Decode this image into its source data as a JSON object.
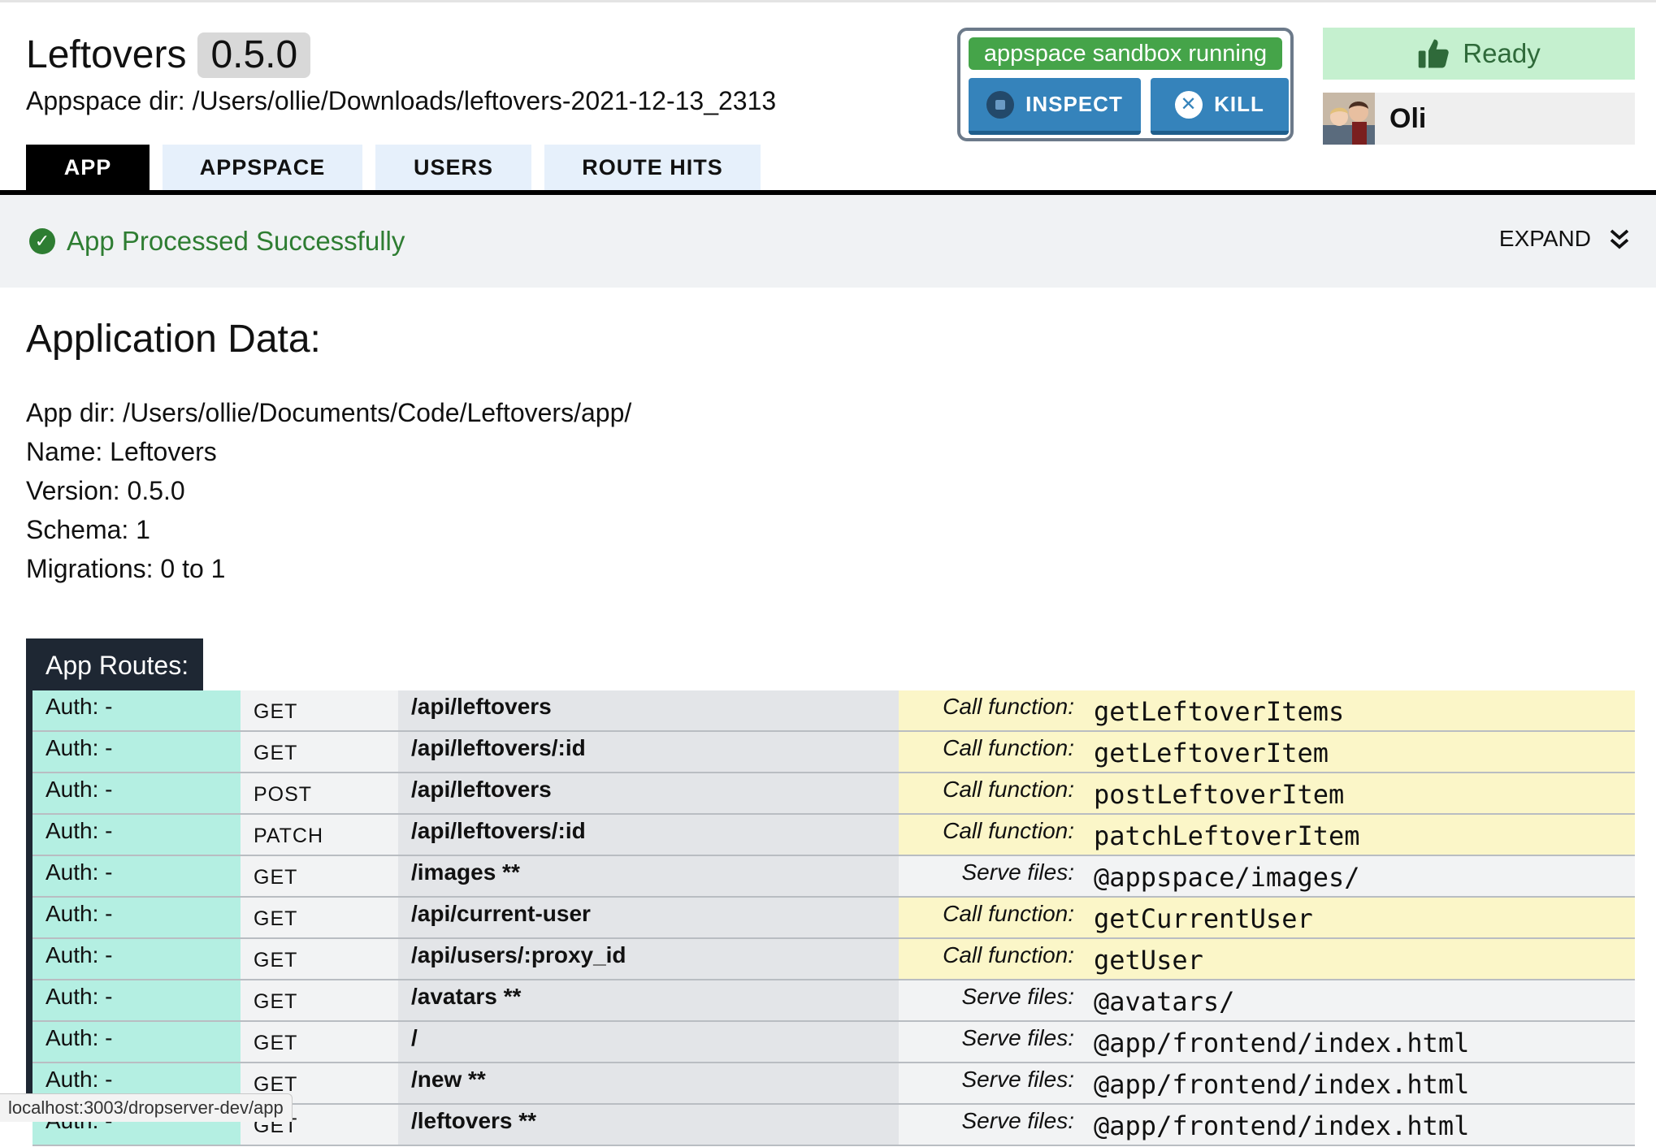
{
  "header": {
    "app_name": "Leftovers",
    "version": "0.5.0",
    "appspace_dir": "Appspace dir: /Users/ollie/Downloads/leftovers-2021-12-13_2313"
  },
  "sandbox": {
    "status": "appspace sandbox running",
    "inspect_label": "INSPECT",
    "kill_label": "KILL"
  },
  "ready": {
    "label": "Ready"
  },
  "user": {
    "name": "Oli"
  },
  "tabs": [
    {
      "label": "APP",
      "active": true
    },
    {
      "label": "APPSPACE",
      "active": false
    },
    {
      "label": "USERS",
      "active": false
    },
    {
      "label": "ROUTE HITS",
      "active": false
    }
  ],
  "status": {
    "message": "App Processed Successfully",
    "expand_label": "EXPAND"
  },
  "app_data": {
    "title": "Application Data:",
    "lines": [
      "App dir: /Users/ollie/Documents/Code/Leftovers/app/",
      "Name: Leftovers",
      "Version: 0.5.0",
      "Schema: 1",
      "Migrations: 0 to 1"
    ]
  },
  "routes": {
    "title": "App Routes:",
    "rows": [
      {
        "auth": "Auth: -",
        "method": "GET",
        "path": "/api/leftovers",
        "handler_type": "Call function:",
        "handler": "getLeftoverItems"
      },
      {
        "auth": "Auth: -",
        "method": "GET",
        "path": "/api/leftovers/:id",
        "handler_type": "Call function:",
        "handler": "getLeftoverItem"
      },
      {
        "auth": "Auth: -",
        "method": "POST",
        "path": "/api/leftovers",
        "handler_type": "Call function:",
        "handler": "postLeftoverItem"
      },
      {
        "auth": "Auth: -",
        "method": "PATCH",
        "path": "/api/leftovers/:id",
        "handler_type": "Call function:",
        "handler": "patchLeftoverItem"
      },
      {
        "auth": "Auth: -",
        "method": "GET",
        "path": "/images **",
        "handler_type": "Serve files:",
        "handler": "@appspace/images/"
      },
      {
        "auth": "Auth: -",
        "method": "GET",
        "path": "/api/current-user",
        "handler_type": "Call function:",
        "handler": "getCurrentUser"
      },
      {
        "auth": "Auth: -",
        "method": "GET",
        "path": "/api/users/:proxy_id",
        "handler_type": "Call function:",
        "handler": "getUser"
      },
      {
        "auth": "Auth: -",
        "method": "GET",
        "path": "/avatars **",
        "handler_type": "Serve files:",
        "handler": "@avatars/"
      },
      {
        "auth": "Auth: -",
        "method": "GET",
        "path": "/",
        "handler_type": "Serve files:",
        "handler": "@app/frontend/index.html"
      },
      {
        "auth": "Auth: -",
        "method": "GET",
        "path": "/new **",
        "handler_type": "Serve files:",
        "handler": "@app/frontend/index.html"
      },
      {
        "auth": "Auth: -",
        "method": "GET",
        "path": "/leftovers **",
        "handler_type": "Serve files:",
        "handler": "@app/frontend/index.html"
      }
    ]
  },
  "browser_status": "localhost:3003/dropserver-dev/app",
  "icons": {
    "ready": "thumbs-up-icon",
    "status": "check-circle-icon",
    "expand": "chevron-double-down-icon",
    "inspect": "stop-icon",
    "kill": "x-circle-icon"
  },
  "colors": {
    "tab_active": "#000000",
    "tab_inactive": "#e6f0fb",
    "sandbox_running": "#45a449",
    "sandbox_buttons": "#3583bb",
    "ready_bg": "#c5f0cf",
    "success_text": "#2e7d32",
    "auth_cell": "#b4efe2",
    "function_cell": "#fbf6c8",
    "routes_header": "#1e2733"
  }
}
